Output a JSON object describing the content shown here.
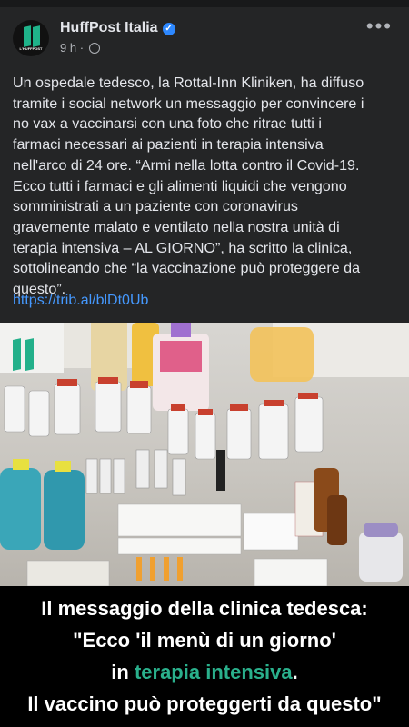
{
  "post": {
    "page_name": "HuffPost Italia",
    "time": "9 h",
    "separator": "·",
    "avatar_label": "L'HUFFPOST",
    "text": "Un ospedale tedesco, la Rottal-Inn Kliniken, ha diffuso\ntramite i social network un messaggio per convincere i\nno vax a vaccinarsi con una foto che ritrae tutti i\nfarmaci necessari ai pazienti in terapia intensiva\nnell'arco di 24 ore. “Armi nella lotta contro il Covid-19.\nEcco tutti i farmaci e gli alimenti liquidi che vengono\nsomministrati a un paziente con coronavirus\ngravemente malato e ventilato nella nostra unità di\nterapia intensiva – AL GIORNO”, ha scritto la clinica,\nsottolineando che “la vaccinazione può proteggere da\nquesto”.",
    "link": "https://trib.al/blDt0Ub"
  },
  "caption": {
    "line1": "Il messaggio della clinica tedesca:",
    "line2": "\"Ecco 'il menù di un giorno'",
    "line3_prefix": "in ",
    "line3_highlight": "terapia intensiva",
    "line3_suffix": ".",
    "line4": "Il vaccino può proteggerti da questo\"",
    "highlight_color": "#2ab08c"
  },
  "icons": [
    "verified-badge-icon",
    "globe-icon",
    "more-options-icon"
  ]
}
